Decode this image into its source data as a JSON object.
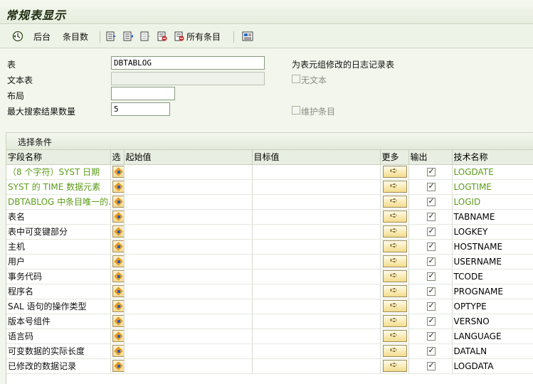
{
  "window": {
    "title": "常规表显示"
  },
  "toolbar": {
    "execute_icon": "execute-clock-icon",
    "background_label": "后台",
    "entry_count_label": "条目数",
    "all_entries_label": "所有条目"
  },
  "form": {
    "table_label": "表",
    "table_value": "DBTABLOG",
    "table_desc": "为表元组修改的日志记录表",
    "text_table_label": "文本表",
    "text_table_value": "",
    "no_text_label": "无文本",
    "layout_label": "布局",
    "layout_value": "",
    "max_hits_label": "最大搜索结果数量",
    "max_hits_value": "5",
    "maintain_entries_label": "维护条目"
  },
  "selection": {
    "title": "选择条件",
    "columns": {
      "field_name": "字段名称",
      "sel": "选",
      "from": "起始值",
      "to": "目标值",
      "more": "更多",
      "output": "输出",
      "tech_name": "技术名称"
    },
    "rows": [
      {
        "field": "（8 个字符）SYST 日期",
        "tech": "LOGDATE",
        "key": true,
        "output": true
      },
      {
        "field": "SYST 的 TIME 数据元素",
        "tech": "LOGTIME",
        "key": true,
        "output": true
      },
      {
        "field": "DBTABLOG 中条目唯一的...",
        "tech": "LOGID",
        "key": true,
        "output": true
      },
      {
        "field": "表名",
        "tech": "TABNAME",
        "key": false,
        "output": true
      },
      {
        "field": "表中可变键部分",
        "tech": "LOGKEY",
        "key": false,
        "output": true
      },
      {
        "field": "主机",
        "tech": "HOSTNAME",
        "key": false,
        "output": true
      },
      {
        "field": "用户",
        "tech": "USERNAME",
        "key": false,
        "output": true
      },
      {
        "field": "事务代码",
        "tech": "TCODE",
        "key": false,
        "output": true
      },
      {
        "field": "程序名",
        "tech": "PROGNAME",
        "key": false,
        "output": true
      },
      {
        "field": "SAL 语句的操作类型",
        "tech": "OPTYPE",
        "key": false,
        "output": true
      },
      {
        "field": "版本号组件",
        "tech": "VERSNO",
        "key": false,
        "output": true
      },
      {
        "field": "语言码",
        "tech": "LANGUAGE",
        "key": false,
        "output": true
      },
      {
        "field": "可变数据的实际长度",
        "tech": "DATALN",
        "key": false,
        "output": true
      },
      {
        "field": "已修改的数据记录",
        "tech": "LOGDATA",
        "key": false,
        "output": true
      }
    ]
  },
  "colors": {
    "key_field": "#5c9c1a",
    "background": "#f2f6ec"
  }
}
